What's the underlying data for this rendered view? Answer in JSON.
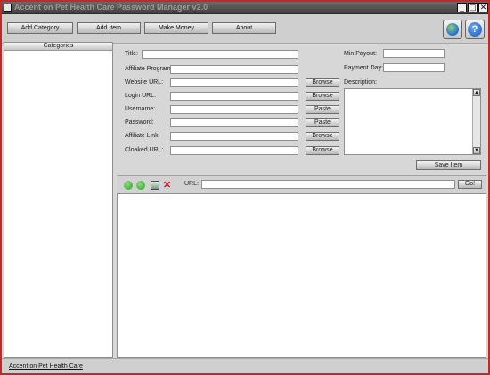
{
  "window": {
    "title": "Accent on Pet Health Care Password Manager v2.0"
  },
  "toolbar": {
    "buttons": [
      "Add Category",
      "Add Item",
      "Make Money",
      "About"
    ],
    "help_glyph": "?"
  },
  "sidebar": {
    "header": "Categories"
  },
  "form": {
    "title_label": "Title:",
    "affiliate_program_label": "Affiliate Program:",
    "website_url_label": "Website URL:",
    "login_url_label": "Login URL:",
    "username_label": "Username:",
    "password_label": "Password:",
    "affiliate_link_label": "Affiliate Link",
    "cloaked_url_label": "Cloaked URL:",
    "min_payout_label": "Min Payout:",
    "payment_day_label": "Payment Day:",
    "description_label": "Description:",
    "browse_label": "Browse",
    "paste_label": "Paste",
    "save_label": "Save Item"
  },
  "browser": {
    "url_label": "URL:",
    "url_value": "",
    "go_label": "Go!"
  },
  "status": {
    "link_text": "Accent on Pet Health Care"
  },
  "icons": [
    "back-icon",
    "forward-icon",
    "refresh-icon",
    "stop-icon",
    "globe-icon",
    "help-icon"
  ],
  "colors": {
    "window_border": "#c62828",
    "panel_bg": "#d7d7d7"
  }
}
